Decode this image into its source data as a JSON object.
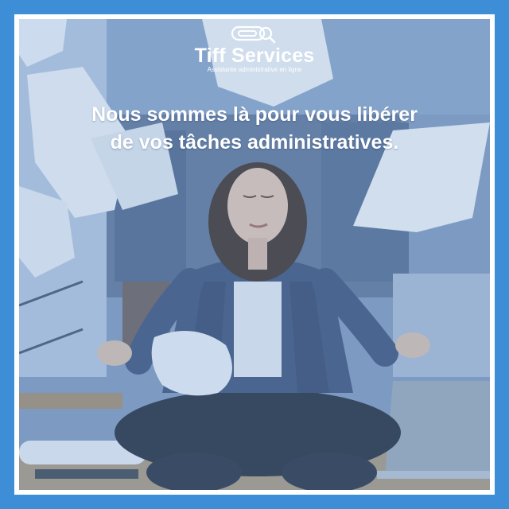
{
  "brand": {
    "name": "Tiff Services",
    "tagline": "Assistante administrative en ligne",
    "logo_icon": "paperclip-magnifier-icon"
  },
  "headline": {
    "line1": "Nous sommes là pour vous libérer",
    "line2": "de vos tâches administratives."
  },
  "colors": {
    "frame": "#3d8ed6",
    "text": "#ffffff"
  },
  "photo": {
    "subject": "meditating-woman-photo"
  }
}
